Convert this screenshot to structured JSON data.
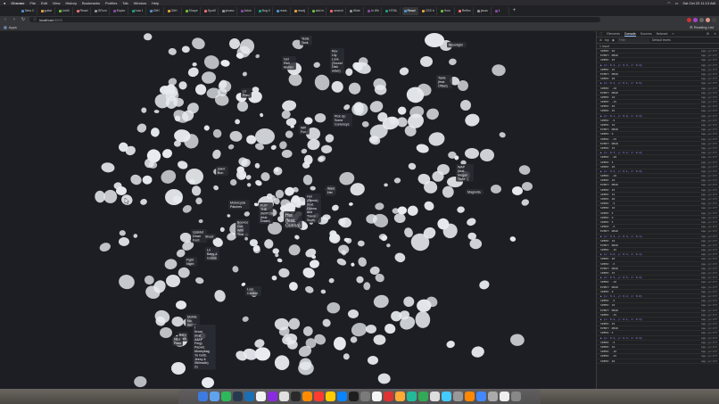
{
  "menubar": {
    "items": [
      "Chrome",
      "File",
      "Edit",
      "View",
      "History",
      "Bookmarks",
      "Profiles",
      "Tab",
      "Window",
      "Help"
    ],
    "clock": "Sat Oct 23  11:13 AM"
  },
  "tabs": [
    {
      "label": "New C"
    },
    {
      "label": "guitar"
    },
    {
      "label": "Untitl"
    },
    {
      "label": "React"
    },
    {
      "label": "GRuni"
    },
    {
      "label": "Explor"
    },
    {
      "label": "how t"
    },
    {
      "label": "GitH"
    },
    {
      "label": "GitH"
    },
    {
      "label": "Shape"
    },
    {
      "label": "Spotif"
    },
    {
      "label": "javasc"
    },
    {
      "label": "Adva"
    },
    {
      "label": "Bug fi"
    },
    {
      "label": "react-"
    },
    {
      "label": "reactj"
    },
    {
      "label": "add m"
    },
    {
      "label": "search"
    },
    {
      "label": "Wide"
    },
    {
      "label": "In Wh"
    },
    {
      "label": "HTML"
    },
    {
      "label": "React"
    },
    {
      "label": "CSS b"
    },
    {
      "label": "How"
    },
    {
      "label": "Reflec"
    },
    {
      "label": "javas"
    },
    {
      "label": "1"
    }
  ],
  "address": {
    "host": "localhost",
    "port": ":3000"
  },
  "bookmarks": {
    "apps_label": "Apps",
    "reading_list": "Reading List"
  },
  "graph": {
    "labels": [
      {
        "id": "l1",
        "lines": [
          "Get",
          "Rich",
          "Mulder"
        ]
      },
      {
        "id": "l2",
        "lines": [
          "Lil",
          "Prim"
        ]
      },
      {
        "id": "l3",
        "lines": [
          "Rev",
          "Lily",
          "Love",
          "(Sound",
          "Disk",
          "wave)"
        ]
      },
      {
        "id": "l4",
        "lines": [
          "Tesla",
          "Tank"
        ]
      },
      {
        "id": "l5",
        "lines": [
          "Moonlight"
        ]
      },
      {
        "id": "l6",
        "lines": [
          "Taste",
          "(feat.",
          "Offset)"
        ]
      },
      {
        "id": "l7",
        "lines": [
          "Pick Up",
          "Some",
          "Currencys"
        ]
      },
      {
        "id": "l8",
        "lines": [
          "Saint",
          "Bon"
        ]
      },
      {
        "id": "l9",
        "lines": [
          "Wifi",
          "Fun"
        ]
      },
      {
        "id": "l10",
        "lines": [
          "RUN",
          "2"
        ]
      },
      {
        "id": "l11",
        "lines": [
          "WAP",
          "(feat.",
          "Megan",
          "Thee...)"
        ]
      },
      {
        "id": "l12",
        "lines": [
          "Magnolia"
        ]
      },
      {
        "id": "l13",
        "lines": [
          "Want",
          "Her"
        ]
      },
      {
        "id": "l14",
        "lines": [
          "Motorcycle",
          "Patches"
        ]
      },
      {
        "id": "l15",
        "lines": [
          "FLIP",
          "THE",
          "SWITCH",
          "(feat.",
          "Drake)"
        ]
      },
      {
        "id": "l16",
        "lines": [
          "Hot",
          "(feat.",
          "Gunna)"
        ]
      },
      {
        "id": "l17",
        "lines": [
          "Hot",
          "(Remix)",
          "(feat.",
          "Gunna",
          "and",
          "Travis",
          "Scott)"
        ]
      },
      {
        "id": "l18",
        "lines": [
          "Bounce",
          "Out",
          "With",
          "That"
        ]
      },
      {
        "id": "l19",
        "lines": [
          "Upsidet",
          "Down",
          "Ford"
        ]
      },
      {
        "id": "l20",
        "lines": [
          "Lil",
          "Baby &",
          "Gunna"
        ]
      },
      {
        "id": "l21",
        "lines": [
          "Shoot"
        ]
      },
      {
        "id": "l22",
        "lines": [
          "Fight",
          "Night"
        ]
      },
      {
        "id": "l23",
        "lines": [
          "Lost",
          "Control"
        ]
      },
      {
        "id": "l24",
        "lines": [
          "Baby",
          "Walk"
        ]
      },
      {
        "id": "l25",
        "lines": [
          "Mobile",
          "No",
          "Sense"
        ]
      },
      {
        "id": "l26",
        "lines": [
          "Nice",
          "Pass"
        ]
      },
      {
        "id": "l27",
        "lines": [
          "I",
          "Know",
          "(feat.",
          "A$AP",
          "Ferg)",
          "Pacwit,",
          "Moneybag",
          "Yo Gotti,",
          "Jeezy &",
          "Stillmatic)",
          "21"
        ]
      }
    ]
  },
  "devtools": {
    "tabs": [
      "Elements",
      "Console",
      "Sources",
      "Network"
    ],
    "active_tab": "Console",
    "context": "top",
    "filter_placeholder": "Filter",
    "levels": "Default levels",
    "issues": "1 Issue",
    "log": [
      {
        "msg": "SPEED: 20",
        "src": "App.js:177",
        "kind": "num"
      },
      {
        "msg": "EVENT: NEAR",
        "src": "App.js:177",
        "kind": "num"
      },
      {
        "msg": "SPEED: 25",
        "src": "App.js:177",
        "kind": "num"
      },
      {
        "msg": "▶ {x: 0.4, y: 0.3, z: 0.2}",
        "src": "App.js:177",
        "kind": "obj"
      },
      {
        "msg": "SPEED: 15",
        "src": "App.js:177",
        "kind": "num"
      },
      {
        "msg": "EVENT: NEAR",
        "src": "App.js:177",
        "kind": "num"
      },
      {
        "msg": "SPEED: 20",
        "src": "App.js:177",
        "kind": "num"
      },
      {
        "msg": "▶ {x: 0.2, y: 0.1, z: 0.5}",
        "src": "App.js:177",
        "kind": "obj"
      },
      {
        "msg": "SPEED: -10",
        "src": "App.js:177",
        "kind": "num"
      },
      {
        "msg": "EVENT: NEAR",
        "src": "App.js:177",
        "kind": "num"
      },
      {
        "msg": "SPEED: 10",
        "src": "App.js:177",
        "kind": "num"
      },
      {
        "msg": "SPEED: -15",
        "src": "App.js:177",
        "kind": "num"
      },
      {
        "msg": "SPEED: 20",
        "src": "App.js:177",
        "kind": "num"
      },
      {
        "msg": "SPEED: 25",
        "src": "App.js:177",
        "kind": "num"
      },
      {
        "msg": "▶ {x: 0.1, y: 0.6, z: 0.3}",
        "src": "App.js:177",
        "kind": "obj"
      },
      {
        "msg": "SPEED: -5",
        "src": "App.js:177",
        "kind": "num"
      },
      {
        "msg": "SPEED: 10",
        "src": "App.js:177",
        "kind": "num"
      },
      {
        "msg": "EVENT: NEAR",
        "src": "App.js:177",
        "kind": "num"
      },
      {
        "msg": "SPEED: 0",
        "src": "App.js:177",
        "kind": "num"
      },
      {
        "msg": "SPEED: -15",
        "src": "App.js:177",
        "kind": "num"
      },
      {
        "msg": "EVENT: NEAR",
        "src": "App.js:177",
        "kind": "num"
      },
      {
        "msg": "SPEED: 15",
        "src": "App.js:177",
        "kind": "num"
      },
      {
        "msg": "▶ {x: 0.3, y: 0.2, z: 0.4}",
        "src": "App.js:177",
        "kind": "obj"
      },
      {
        "msg": "SPEED: -20",
        "src": "App.js:177",
        "kind": "num"
      },
      {
        "msg": "SPEED: 5",
        "src": "App.js:177",
        "kind": "num"
      },
      {
        "msg": "SPEED: 20",
        "src": "App.js:177",
        "kind": "num"
      },
      {
        "msg": "▶ {x: 0.5, y: 0.1, z: 0.2}",
        "src": "App.js:177",
        "kind": "obj"
      },
      {
        "msg": "SPEED: -10",
        "src": "App.js:177",
        "kind": "num"
      },
      {
        "msg": "SPEED: 10",
        "src": "App.js:177",
        "kind": "num"
      },
      {
        "msg": "EVENT: NEAR",
        "src": "App.js:177",
        "kind": "num"
      },
      {
        "msg": "SPEED: 25",
        "src": "App.js:177",
        "kind": "num"
      },
      {
        "msg": "SPEED: 15",
        "src": "App.js:177",
        "kind": "num"
      },
      {
        "msg": "SPEED: 20",
        "src": "App.js:177",
        "kind": "num"
      },
      {
        "msg": "SPEED: -5",
        "src": "App.js:177",
        "kind": "num"
      },
      {
        "msg": "SPEED: 10",
        "src": "App.js:177",
        "kind": "num"
      },
      {
        "msg": "SPEED: 5",
        "src": "App.js:177",
        "kind": "num"
      },
      {
        "msg": "SPEED: 0",
        "src": "App.js:177",
        "kind": "num"
      },
      {
        "msg": "SPEED: 5",
        "src": "App.js:177",
        "kind": "num"
      },
      {
        "msg": "SPEED: -5",
        "src": "App.js:177",
        "kind": "num"
      },
      {
        "msg": "EVENT: NEAR",
        "src": "App.js:177",
        "kind": "num"
      },
      {
        "msg": "▶ {x: 0.2, y: 0.4, z: 0.1}",
        "src": "App.js:177",
        "kind": "obj"
      },
      {
        "msg": "SPEED: 10",
        "src": "App.js:177",
        "kind": "num"
      },
      {
        "msg": "EVENT: NEAR",
        "src": "App.js:177",
        "kind": "num"
      },
      {
        "msg": "SPEED: -15",
        "src": "App.js:177",
        "kind": "num"
      },
      {
        "msg": "▶ {x: 0.6, y: 0.3, z: 0.1}",
        "src": "App.js:177",
        "kind": "obj"
      },
      {
        "msg": "SPEED: 20",
        "src": "App.js:177",
        "kind": "num"
      },
      {
        "msg": "SPEED: -5",
        "src": "App.js:177",
        "kind": "num"
      },
      {
        "msg": "EVENT: NEAR",
        "src": "App.js:177",
        "kind": "num"
      },
      {
        "msg": "SPEED: 15",
        "src": "App.js:177",
        "kind": "num"
      },
      {
        "msg": "▶ {x: 0.3, y: 0.5, z: 0.2}",
        "src": "App.js:177",
        "kind": "obj"
      },
      {
        "msg": "SPEED: -10",
        "src": "App.js:177",
        "kind": "num"
      },
      {
        "msg": "EVENT: NEAR",
        "src": "App.js:177",
        "kind": "num"
      },
      {
        "msg": "SPEED: 0",
        "src": "App.js:177",
        "kind": "num"
      },
      {
        "msg": "▶ {x: 0.1, y: 0.2, z: 0.6}",
        "src": "App.js:177",
        "kind": "obj"
      },
      {
        "msg": "SPEED: -5",
        "src": "App.js:177",
        "kind": "num"
      },
      {
        "msg": "SPEED: 10",
        "src": "App.js:177",
        "kind": "num"
      },
      {
        "msg": "EVENT: NEAR",
        "src": "App.js:177",
        "kind": "num"
      },
      {
        "msg": "SPEED: -15",
        "src": "App.js:177",
        "kind": "num"
      },
      {
        "msg": "▶ {x: 0.4, y: 0.1, z: 0.3}",
        "src": "App.js:177",
        "kind": "obj"
      },
      {
        "msg": "SPEED: 25",
        "src": "App.js:177",
        "kind": "num"
      },
      {
        "msg": "EVENT: NEAR",
        "src": "App.js:177",
        "kind": "num"
      },
      {
        "msg": "SPEED: 5",
        "src": "App.js:177",
        "kind": "num"
      },
      {
        "msg": "▶ {x: 0.2, y: 0.3, z: 0.4}",
        "src": "App.js:177",
        "kind": "obj"
      },
      {
        "msg": "SPEED: -5",
        "src": "App.js:177",
        "kind": "num"
      },
      {
        "msg": "SPEED: 10",
        "src": "App.js:177",
        "kind": "num"
      },
      {
        "msg": "SPEED: -10",
        "src": "App.js:177",
        "kind": "num"
      },
      {
        "msg": "SPEED: -15",
        "src": "App.js:177",
        "kind": "num"
      },
      {
        "msg": "SPEED: 20",
        "src": "App.js:177",
        "kind": "num"
      }
    ]
  },
  "colors": {
    "canvas_bg": "#1c1e24",
    "node_fill": "#e8ebef",
    "label_bg": "#2a2d34",
    "accent": "#8ab4f8"
  }
}
